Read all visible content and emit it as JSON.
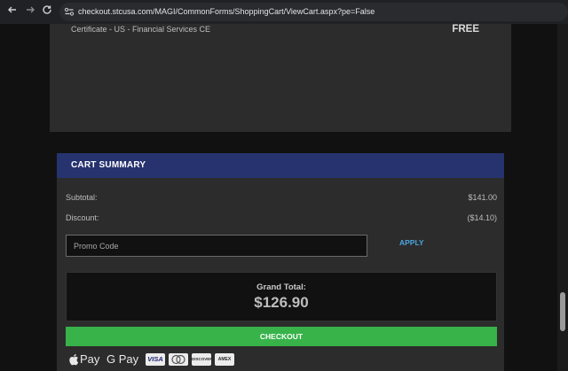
{
  "browser": {
    "url": "checkout.stcusa.com/MAGI/CommonForms/ShoppingCart/ViewCart.aspx?pe=False"
  },
  "product": {
    "name": "Certificate - US - Financial Services CE",
    "price": "FREE"
  },
  "cart_summary": {
    "title": "CART SUMMARY",
    "subtotal_label": "Subtotal:",
    "subtotal_value": "$141.00",
    "discount_label": "Discount:",
    "discount_value": "($14.10)",
    "promo_placeholder": "Promo Code",
    "apply_label": "APPLY",
    "grand_total_label": "Grand Total:",
    "grand_total_value": "$126.90",
    "checkout_label": "CHECKOUT"
  },
  "payment_methods": {
    "apple_pay": "Pay",
    "google_pay": "G Pay",
    "visa": "VISA",
    "mastercard": "MC",
    "discover": "DISCOVER",
    "amex": "AMEX"
  },
  "colors": {
    "header_blue": "#27336f",
    "checkout_green": "#37b34a",
    "apply_blue": "#4aa3e0"
  }
}
